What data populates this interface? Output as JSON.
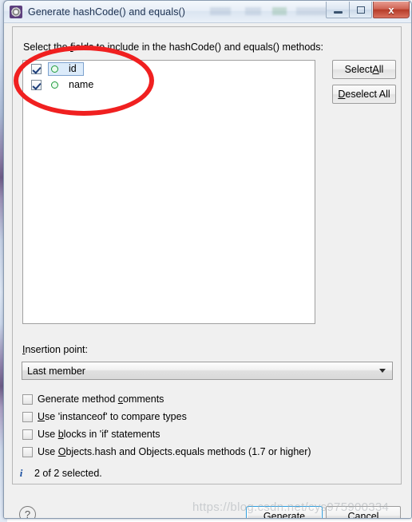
{
  "window": {
    "title": "Generate hashCode() and equals()",
    "icon": "gear-icon",
    "controls": {
      "minimize": "–",
      "maximize": "□",
      "close": "x"
    }
  },
  "dialog": {
    "prompt_before": "Select the ",
    "prompt_accel": "f",
    "prompt_after": "ields to include in the hashCode() and equals() methods:",
    "fields": [
      {
        "name": "id",
        "checked": true,
        "selected": true,
        "icon": "green-circle-field-icon"
      },
      {
        "name": "name",
        "checked": true,
        "selected": false,
        "icon": "green-circle-field-icon"
      }
    ],
    "side_buttons": {
      "select_all_pre": "Select ",
      "select_all_accel": "A",
      "select_all_post": "ll",
      "deselect_all_accel": "D",
      "deselect_all_post": "eselect All"
    },
    "insertion": {
      "label_accel": "I",
      "label_rest": "nsertion point:",
      "value": "Last member",
      "arrow": "chevron-down-icon"
    },
    "options": [
      {
        "pre": "Generate method ",
        "accel": "c",
        "post": "omments",
        "checked": false
      },
      {
        "pre": "",
        "accel": "U",
        "post": "se 'instanceof' to compare types",
        "checked": false
      },
      {
        "pre": "Use ",
        "accel": "b",
        "post": "locks in 'if' statements",
        "checked": false
      },
      {
        "pre": "Use ",
        "accel": "O",
        "post": "bjects.hash and Objects.equals methods (1.7 or higher)",
        "checked": false
      }
    ],
    "status": {
      "icon": "info-icon",
      "text": "2 of 2 selected."
    },
    "footer": {
      "help": "?",
      "generate_accel": "G",
      "generate_post": "enerate",
      "cancel": "Cancel"
    }
  },
  "annotation": {
    "shape": "red-ellipse-highlight"
  },
  "watermark": {
    "text": "https://blog.csdn.net/cys975900334"
  }
}
